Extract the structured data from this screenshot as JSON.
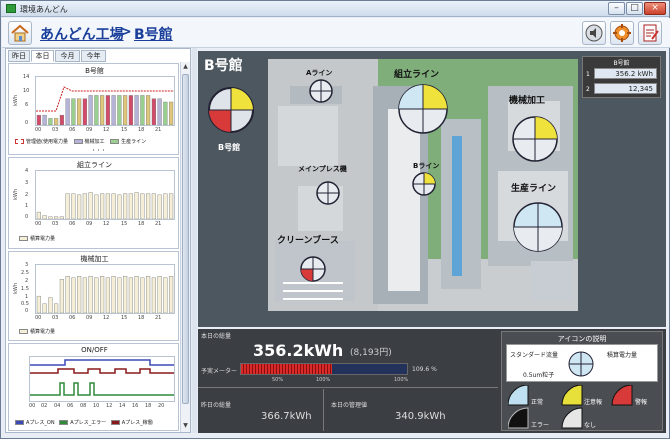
{
  "window": {
    "title": "環境あんどん"
  },
  "breadcrumb": {
    "parent": "あんどん工場",
    "separator": ">",
    "current": "B号館"
  },
  "tabs": [
    "昨日",
    "本日",
    "今月",
    "今年"
  ],
  "charts": {
    "c1": {
      "title": "B号館",
      "ylabel": "kWh",
      "legend": [
        "管理値(使用電力量",
        "機械加工",
        "生産ライン"
      ],
      "more": "・・・"
    },
    "c2": {
      "title": "組立ライン",
      "ylabel": "kWh",
      "legend": [
        "積算電力量"
      ]
    },
    "c3": {
      "title": "機械加工",
      "ylabel": "kWh",
      "legend": [
        "積算電力量"
      ]
    },
    "c4": {
      "title": "ON/OFF",
      "legend": [
        "Aプレス_ON",
        "Aプレス_エラー",
        "Aプレス_稼働"
      ]
    }
  },
  "chart_data": [
    {
      "type": "bar",
      "title": "B号館",
      "ylabel": "kWh",
      "categories": [
        "00",
        "03",
        "06",
        "09",
        "12",
        "15",
        "18",
        "21"
      ],
      "values": [
        3,
        3,
        2,
        2,
        3,
        8,
        8,
        8,
        8,
        9,
        9,
        9,
        9,
        9,
        9,
        9,
        9,
        9,
        9,
        9,
        8,
        8,
        7,
        7
      ],
      "yticks": [
        "0",
        "2",
        "4",
        "6",
        "8",
        "10",
        "12",
        "14"
      ],
      "ylim": [
        0,
        14
      ]
    },
    {
      "type": "bar",
      "title": "組立ライン",
      "ylabel": "kWh",
      "categories": [
        "00",
        "03",
        "06",
        "09",
        "12",
        "15",
        "18",
        "21"
      ],
      "values": [
        0.6,
        0.3,
        0.2,
        0.2,
        0.2,
        2.2,
        2.2,
        2.1,
        2.2,
        2.3,
        2.1,
        2.2,
        2.2,
        2.2,
        2.1,
        2.2,
        2.2,
        2.3,
        2.2,
        2.2,
        2.2,
        2.1,
        2.2,
        2.2
      ],
      "yticks": [
        "0",
        "1",
        "2",
        "3",
        "4"
      ],
      "ylim": [
        0,
        4
      ]
    },
    {
      "type": "bar",
      "title": "機械加工",
      "ylabel": "kWh",
      "categories": [
        "00",
        "03",
        "06",
        "09",
        "12",
        "15",
        "18",
        "21"
      ],
      "values": [
        1.1,
        0.6,
        1.0,
        0.6,
        2.2,
        2.4,
        2.3,
        2.4,
        2.3,
        2.4,
        2.3,
        2.4,
        2.3,
        2.4,
        2.3,
        2.4,
        2.3,
        2.4,
        2.3,
        2.4,
        2.3,
        2.4,
        2.3,
        2.4
      ],
      "yticks": [
        "0",
        "0.5",
        "1",
        "1.5",
        "2",
        "2.5",
        "3"
      ],
      "ylim": [
        0,
        3
      ]
    },
    {
      "type": "line",
      "title": "ON/OFF",
      "categories": [
        "00",
        "02",
        "04",
        "06",
        "08",
        "10",
        "12",
        "14",
        "16",
        "18",
        "20",
        "22"
      ],
      "ylim": [
        0,
        1
      ]
    }
  ],
  "map": {
    "title": "B号館",
    "labels": {
      "a_line": "Aライン",
      "kumitate": "組立ライン",
      "kikai": "機械加工",
      "main_press": "メインプレス機",
      "b_line": "Bライン",
      "seisan": "生産ライン",
      "clean_booth": "クリーンブース",
      "building": "B号館"
    }
  },
  "info_box": {
    "title": "B号館",
    "rows": [
      {
        "idx": "1",
        "value": "356.2 kWh"
      },
      {
        "idx": "2",
        "value": "12,345"
      }
    ]
  },
  "summary": {
    "today_label": "本日の総量",
    "today_value": "356.2kWh",
    "today_yen": "(8,193円)",
    "forecast_label": "予実メーター",
    "forecast_pct": "109.6 %",
    "forecast_fill": 1.096,
    "scale": [
      "50%",
      "100%",
      "100%"
    ],
    "yesterday_label": "昨日の総量",
    "yesterday_value": "366.7kWh",
    "target_label": "本日の管理値",
    "target_value": "340.9kWh"
  },
  "legend_box": {
    "title": "アイコンの説明",
    "flow": "スタンダード流量",
    "flow2": "0.5um粒子",
    "power": "積算電力量",
    "normal": "正常",
    "caution": "注意報",
    "warning": "警報",
    "error": "エラー",
    "none": "なし"
  },
  "colors": {
    "accent": "#1a3f9b",
    "caution": "#e8e03a",
    "warning": "#d83a3a",
    "normal": "#bfe0f0"
  }
}
